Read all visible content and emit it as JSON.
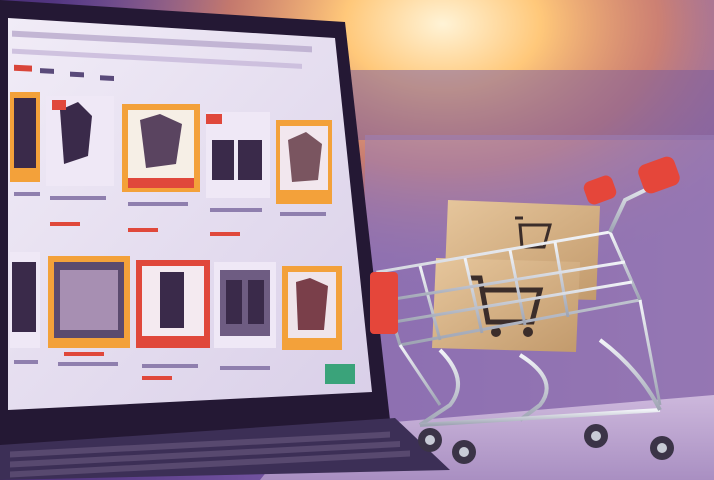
{
  "scene": {
    "subject": "laptop-with-online-shop-and-mini-shopping-cart",
    "palette": {
      "bg_violet": "#6b4aa0",
      "bg_purple_dark": "#3b2566",
      "window_glow": "#ffd9a0",
      "window_orange": "#f5a04a",
      "laptop_bezel": "#2a1d43",
      "screen_light": "#e9e3f2",
      "product_orange": "#f3a13a",
      "product_red": "#e0483b",
      "product_dark": "#3a2a4a",
      "cart_chrome": "#cfd3dc",
      "cart_red": "#e5463a",
      "box_kraft": "#d7b48a",
      "box_print": "#3b2d2a",
      "keyboard": "#4a3d63"
    }
  },
  "screen": {
    "grid_rows": [
      {
        "items": [
          "product",
          "product",
          "product",
          "product",
          "product"
        ]
      },
      {
        "items": [
          "product",
          "product",
          "product",
          "product",
          "product",
          "product"
        ]
      }
    ]
  },
  "cart": {
    "boxes": [
      {
        "print": "shopping-cart-logo"
      },
      {
        "print": "shopping-cart-logo"
      }
    ]
  }
}
